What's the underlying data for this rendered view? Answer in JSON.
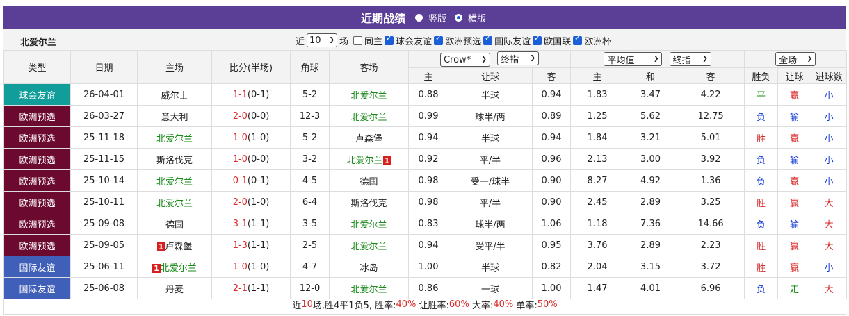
{
  "header": {
    "title": "近期战绩",
    "view_vertical": "竖版",
    "view_horizontal": "横版"
  },
  "filter": {
    "team": "北爱尔兰",
    "near_label": "近",
    "count": "10",
    "field_label": "场",
    "same_home": "同主",
    "types": [
      "球会友谊",
      "欧洲预选",
      "国际友谊",
      "欧国联",
      "欧洲杯"
    ],
    "types_checked": [
      true,
      true,
      true,
      true,
      true
    ],
    "same_home_checked": false
  },
  "table": {
    "headers": {
      "type": "类型",
      "date": "日期",
      "home": "主场",
      "score": "比分(半场)",
      "corners": "角球",
      "away": "客场",
      "company": "Crow*",
      "asia_kind": "终指",
      "eu_kind": "平均值",
      "eu_kind2": "终指",
      "scope": "全场",
      "home_sub": "主",
      "handicap_sub": "让球",
      "away_sub": "客",
      "eu_home": "主",
      "eu_draw": "和",
      "eu_away": "客",
      "win_loss": "胜负",
      "handicap_res": "让球",
      "goals": "进球数"
    },
    "rows": [
      {
        "type": "球会友谊",
        "type_color": "#119e9a",
        "date": "26-04-01",
        "home": "威尔士",
        "home_green": false,
        "home_card": "",
        "score": "1-1",
        "half": "(0-1)",
        "corners": "5-2",
        "away": "北爱尔兰",
        "away_green": true,
        "away_card": "",
        "h_home": "0.88",
        "handicap": "半球",
        "h_away": "0.94",
        "e_home": "1.83",
        "e_draw": "3.47",
        "e_away": "4.22",
        "wl": "平",
        "wl_color": "#1a8a1a",
        "hr": "赢",
        "hr_color": "#d92b2b",
        "g": "小",
        "g_color": "#1a3fd6"
      },
      {
        "type": "欧洲预选",
        "type_color": "#6b0a2e",
        "date": "26-03-27",
        "home": "意大利",
        "home_green": false,
        "home_card": "",
        "score": "2-0",
        "half": "(0-0)",
        "corners": "12-3",
        "away": "北爱尔兰",
        "away_green": true,
        "away_card": "",
        "h_home": "0.99",
        "handicap": "球半/两",
        "h_away": "0.89",
        "e_home": "1.25",
        "e_draw": "5.62",
        "e_away": "12.75",
        "wl": "负",
        "wl_color": "#1a3fd6",
        "hr": "输",
        "hr_color": "#1a3fd6",
        "g": "小",
        "g_color": "#1a3fd6"
      },
      {
        "type": "欧洲预选",
        "type_color": "#6b0a2e",
        "date": "25-11-18",
        "home": "北爱尔兰",
        "home_green": true,
        "home_card": "",
        "score": "1-0",
        "half": "(1-0)",
        "corners": "5-2",
        "away": "卢森堡",
        "away_green": false,
        "away_card": "",
        "h_home": "0.94",
        "handicap": "半球",
        "h_away": "0.94",
        "e_home": "1.84",
        "e_draw": "3.21",
        "e_away": "5.01",
        "wl": "胜",
        "wl_color": "#d92b2b",
        "hr": "赢",
        "hr_color": "#d92b2b",
        "g": "小",
        "g_color": "#1a3fd6"
      },
      {
        "type": "欧洲预选",
        "type_color": "#6b0a2e",
        "date": "25-11-15",
        "home": "斯洛伐克",
        "home_green": false,
        "home_card": "",
        "score": "1-0",
        "half": "(0-0)",
        "corners": "3-2",
        "away": "北爱尔兰",
        "away_green": true,
        "away_card": "1",
        "h_home": "0.92",
        "handicap": "平/半",
        "h_away": "0.96",
        "e_home": "2.13",
        "e_draw": "3.00",
        "e_away": "3.92",
        "wl": "负",
        "wl_color": "#1a3fd6",
        "hr": "输",
        "hr_color": "#1a3fd6",
        "g": "小",
        "g_color": "#1a3fd6"
      },
      {
        "type": "欧洲预选",
        "type_color": "#6b0a2e",
        "date": "25-10-14",
        "home": "北爱尔兰",
        "home_green": true,
        "home_card": "",
        "score": "0-1",
        "half": "(0-1)",
        "corners": "4-5",
        "away": "德国",
        "away_green": false,
        "away_card": "",
        "h_home": "0.98",
        "handicap": "受一/球半",
        "h_away": "0.90",
        "e_home": "8.27",
        "e_draw": "4.92",
        "e_away": "1.36",
        "wl": "负",
        "wl_color": "#1a3fd6",
        "hr": "赢",
        "hr_color": "#d92b2b",
        "g": "小",
        "g_color": "#1a3fd6"
      },
      {
        "type": "欧洲预选",
        "type_color": "#6b0a2e",
        "date": "25-10-11",
        "home": "北爱尔兰",
        "home_green": true,
        "home_card": "",
        "score": "2-0",
        "half": "(1-0)",
        "corners": "6-4",
        "away": "斯洛伐克",
        "away_green": false,
        "away_card": "",
        "h_home": "0.98",
        "handicap": "平/半",
        "h_away": "0.90",
        "e_home": "2.45",
        "e_draw": "2.89",
        "e_away": "3.25",
        "wl": "胜",
        "wl_color": "#d92b2b",
        "hr": "赢",
        "hr_color": "#d92b2b",
        "g": "大",
        "g_color": "#d92b2b"
      },
      {
        "type": "欧洲预选",
        "type_color": "#6b0a2e",
        "date": "25-09-08",
        "home": "德国",
        "home_green": false,
        "home_card": "",
        "score": "3-1",
        "half": "(1-1)",
        "corners": "3-5",
        "away": "北爱尔兰",
        "away_green": true,
        "away_card": "",
        "h_home": "0.83",
        "handicap": "球半/两",
        "h_away": "1.06",
        "e_home": "1.18",
        "e_draw": "7.36",
        "e_away": "14.66",
        "wl": "负",
        "wl_color": "#1a3fd6",
        "hr": "输",
        "hr_color": "#1a3fd6",
        "g": "大",
        "g_color": "#d92b2b"
      },
      {
        "type": "欧洲预选",
        "type_color": "#6b0a2e",
        "date": "25-09-05",
        "home": "卢森堡",
        "home_green": false,
        "home_card": "1",
        "score": "1-3",
        "half": "(1-1)",
        "corners": "2-5",
        "away": "北爱尔兰",
        "away_green": true,
        "away_card": "",
        "h_home": "0.94",
        "handicap": "受平/半",
        "h_away": "0.95",
        "e_home": "3.76",
        "e_draw": "2.89",
        "e_away": "2.23",
        "wl": "胜",
        "wl_color": "#d92b2b",
        "hr": "赢",
        "hr_color": "#d92b2b",
        "g": "大",
        "g_color": "#d92b2b"
      },
      {
        "type": "国际友谊",
        "type_color": "#3f5fb8",
        "date": "25-06-11",
        "home": "北爱尔兰",
        "home_green": true,
        "home_card": "1",
        "score": "1-0",
        "half": "(1-0)",
        "corners": "4-7",
        "away": "冰岛",
        "away_green": false,
        "away_card": "",
        "h_home": "1.00",
        "handicap": "半球",
        "h_away": "0.82",
        "e_home": "2.04",
        "e_draw": "3.15",
        "e_away": "3.72",
        "wl": "胜",
        "wl_color": "#d92b2b",
        "hr": "赢",
        "hr_color": "#d92b2b",
        "g": "小",
        "g_color": "#1a3fd6"
      },
      {
        "type": "国际友谊",
        "type_color": "#3f5fb8",
        "date": "25-06-08",
        "home": "丹麦",
        "home_green": false,
        "home_card": "",
        "score": "2-1",
        "half": "(1-1)",
        "corners": "12-0",
        "away": "北爱尔兰",
        "away_green": true,
        "away_card": "",
        "h_home": "0.86",
        "handicap": "一球",
        "h_away": "1.00",
        "e_home": "1.47",
        "e_draw": "4.01",
        "e_away": "6.96",
        "wl": "负",
        "wl_color": "#1a3fd6",
        "hr": "走",
        "hr_color": "#1a8a1a",
        "g": "大",
        "g_color": "#d92b2b"
      }
    ]
  },
  "summary": {
    "p1": "近",
    "matches": "10",
    "p2": "场,胜4平1负5, 胜率:",
    "win_rate": "40%",
    "p3": " 让胜率:",
    "handi_rate": "60%",
    "p4": " 大率:",
    "big_rate": "40%",
    "p5": " 单率:",
    "odd_rate": "50%"
  },
  "colors": {
    "title_bg": "#5b3e96",
    "club_friendly": "#119e9a",
    "euro_qual": "#6b0a2e",
    "intl_friendly": "#3f5fb8",
    "team_green": "#1a8a1a",
    "red": "#d92b2b",
    "blue": "#1a3fd6"
  }
}
